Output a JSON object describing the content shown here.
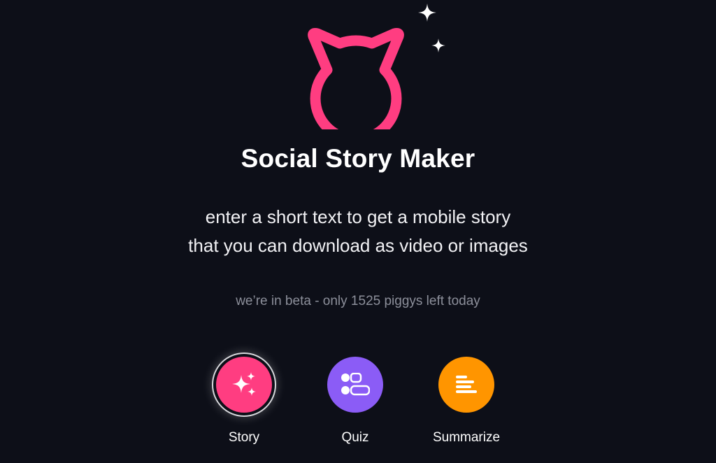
{
  "app": {
    "title": "Social Story Maker",
    "subtitle_line1": "enter a short text to get a mobile story",
    "subtitle_line2": "that you can download as video or images",
    "beta_notice": "we’re in beta - only 1525 piggys left today"
  },
  "logo": {
    "icon": "cat-head-outline-icon",
    "color": "#ff3d81"
  },
  "decorations": {
    "sparkle_icon": "four-point-star-icon",
    "color": "#ffffff"
  },
  "modes": [
    {
      "id": "story",
      "label": "Story",
      "icon": "sparkles-icon",
      "color": "#ff3d81",
      "selected": true
    },
    {
      "id": "quiz",
      "label": "Quiz",
      "icon": "quiz-options-icon",
      "color": "#8b5cf6",
      "selected": false
    },
    {
      "id": "summarize",
      "label": "Summarize",
      "icon": "text-lines-icon",
      "color": "#ff9500",
      "selected": false
    }
  ]
}
